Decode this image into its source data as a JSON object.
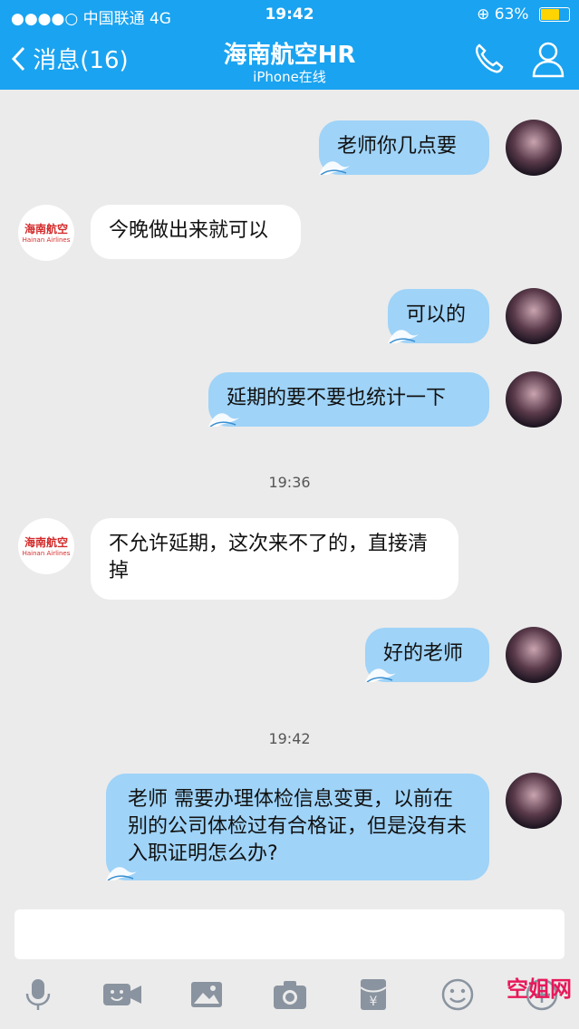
{
  "status": {
    "carrier": "●●●●○ 中国联通  4G",
    "time": "19:42",
    "battery": "63%"
  },
  "nav": {
    "back_label": "消息(16)",
    "title": "海南航空HR",
    "subtitle": "iPhone在线"
  },
  "avatars": {
    "hainan_logo_text": "海南航空",
    "hainan_sub_text": "Hainan Airlines"
  },
  "messages": [
    {
      "side": "out",
      "text": "老师你几点要"
    },
    {
      "side": "in",
      "text": "今晚做出来就可以"
    },
    {
      "side": "out",
      "text": "可以的"
    },
    {
      "side": "out",
      "text": "延期的要不要也统计一下"
    },
    {
      "side": "in",
      "text": "不允许延期，这次来不了的，直接清掉"
    },
    {
      "side": "out",
      "text": "好的老师"
    },
    {
      "side": "out",
      "text": "老师 需要办理体检信息变更，以前在别的公司体检过有合格证，但是没有未入职证明怎么办?"
    }
  ],
  "timestamps": [
    "19:36",
    "19:42"
  ],
  "toolbar": [
    "mic-icon",
    "video-icon",
    "image-icon",
    "camera-icon",
    "red-packet-icon",
    "emoji-icon",
    "plus-icon"
  ],
  "watermark": "空姐网",
  "colors": {
    "accent": "#1aa3f0",
    "out_bubble": "#9fd3f8",
    "in_bubble": "#ffffff",
    "background": "#ebebeb"
  }
}
